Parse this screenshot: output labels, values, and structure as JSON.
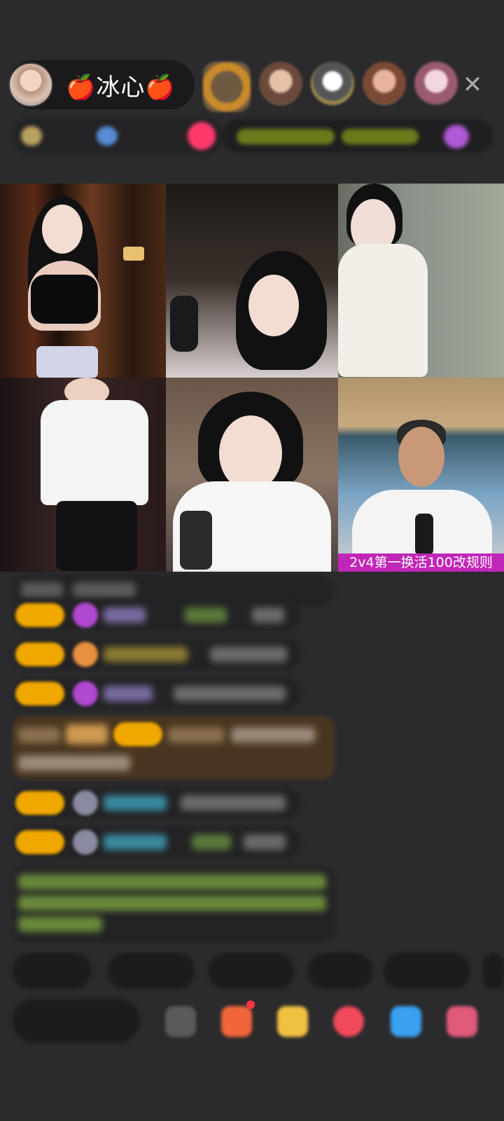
{
  "host": {
    "name": "🍎冰心🍎"
  },
  "close_icon": "close-icon",
  "video_grid": {
    "banner": "2v4第一换活100改规则",
    "banner_color": "#c026b8"
  },
  "colors": {
    "background": "#2b2b2d",
    "badge": "#f0a800",
    "banner": "#c026b8",
    "notification_dot": "#ff3344"
  }
}
